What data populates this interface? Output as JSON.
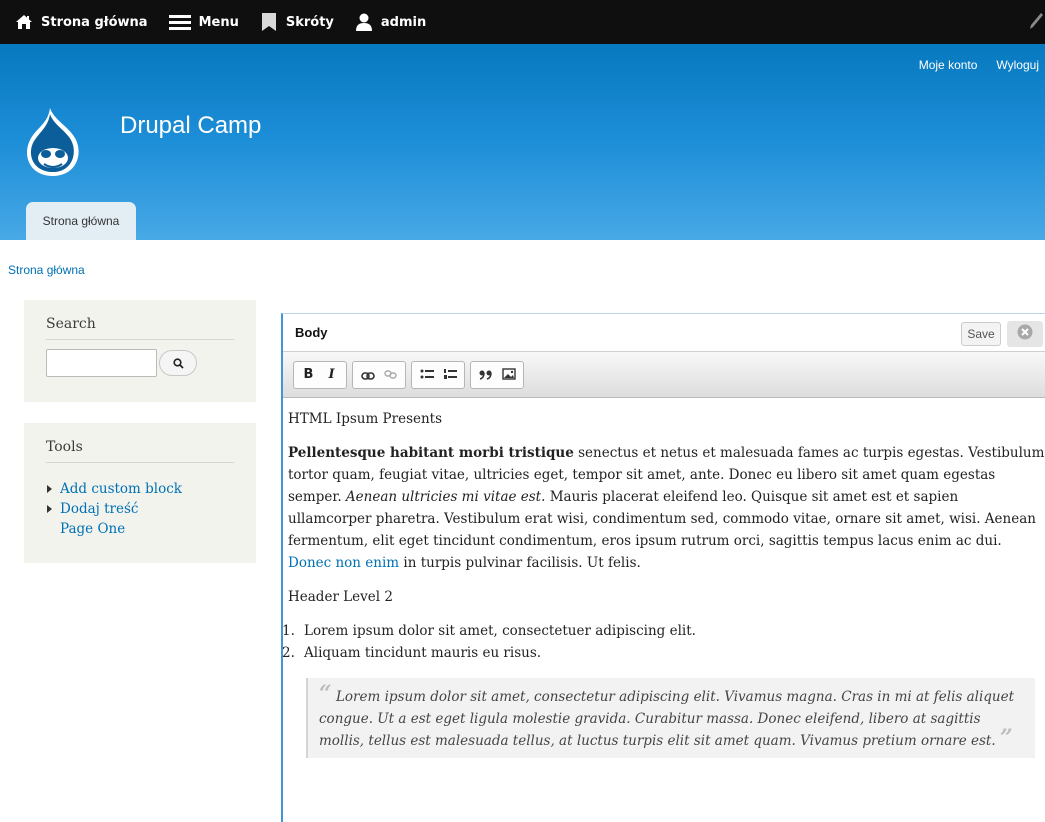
{
  "toolbar": {
    "home": "Strona główna",
    "menu": "Menu",
    "shortcuts": "Skróty",
    "user": "admin"
  },
  "header": {
    "my_account": "Moje konto",
    "logout": "Wyloguj",
    "site_name": "Drupal Camp",
    "tab": "Strona główna"
  },
  "breadcrumb": "Strona główna",
  "sidebar": {
    "search_title": "Search",
    "tools_title": "Tools",
    "tools": [
      {
        "label": "Add custom block"
      },
      {
        "label": "Dodaj treść"
      },
      {
        "label": "Page One"
      }
    ]
  },
  "editor": {
    "title": "Body",
    "save": "Save",
    "para1": "HTML Ipsum Presents",
    "para2_bold": "Pellentesque habitant morbi tristique",
    "para2_a": " senectus et netus et malesuada fames ac turpis egestas. Vestibulum tortor quam, feugiat vitae, ultricies eget, tempor sit amet, ante. Donec eu libero sit amet quam egestas semper. ",
    "para2_italic": "Aenean ultricies mi vitae est.",
    "para2_b": " Mauris placerat eleifend leo. Quisque sit amet est et sapien ullamcorper pharetra. Vestibulum erat wisi, condimentum sed, commodo vitae, ornare sit amet, wisi. Aenean fermentum, elit eget tincidunt condimentum, eros ipsum rutrum orci, sagittis tempus lacus enim ac dui. ",
    "para2_link": "Donec non enim",
    "para2_c": " in turpis pulvinar facilisis. Ut felis.",
    "header_level": "Header Level 2",
    "list": [
      {
        "num": "1.",
        "text": "Lorem ipsum dolor sit amet, consectetuer adipiscing elit."
      },
      {
        "num": "2.",
        "text": "Aliquam tincidunt mauris eu risus."
      }
    ],
    "quote": "Lorem ipsum dolor sit amet, consectetur adipiscing elit. Vivamus magna. Cras in mi at felis aliquet congue. Ut a est eget ligula molestie gravida. Curabitur massa. Donec eleifend, libero at sagittis mollis, tellus est malesuada tellus, at luctus turpis elit sit amet quam. Vivamus pretium ornare est."
  },
  "colors": {
    "toolbar_bg": "#0f0f0f",
    "header_top": "#0779bf",
    "header_bottom": "#48a9e6",
    "link": "#0071b3",
    "sidebar_bg": "#f3f3ee"
  }
}
